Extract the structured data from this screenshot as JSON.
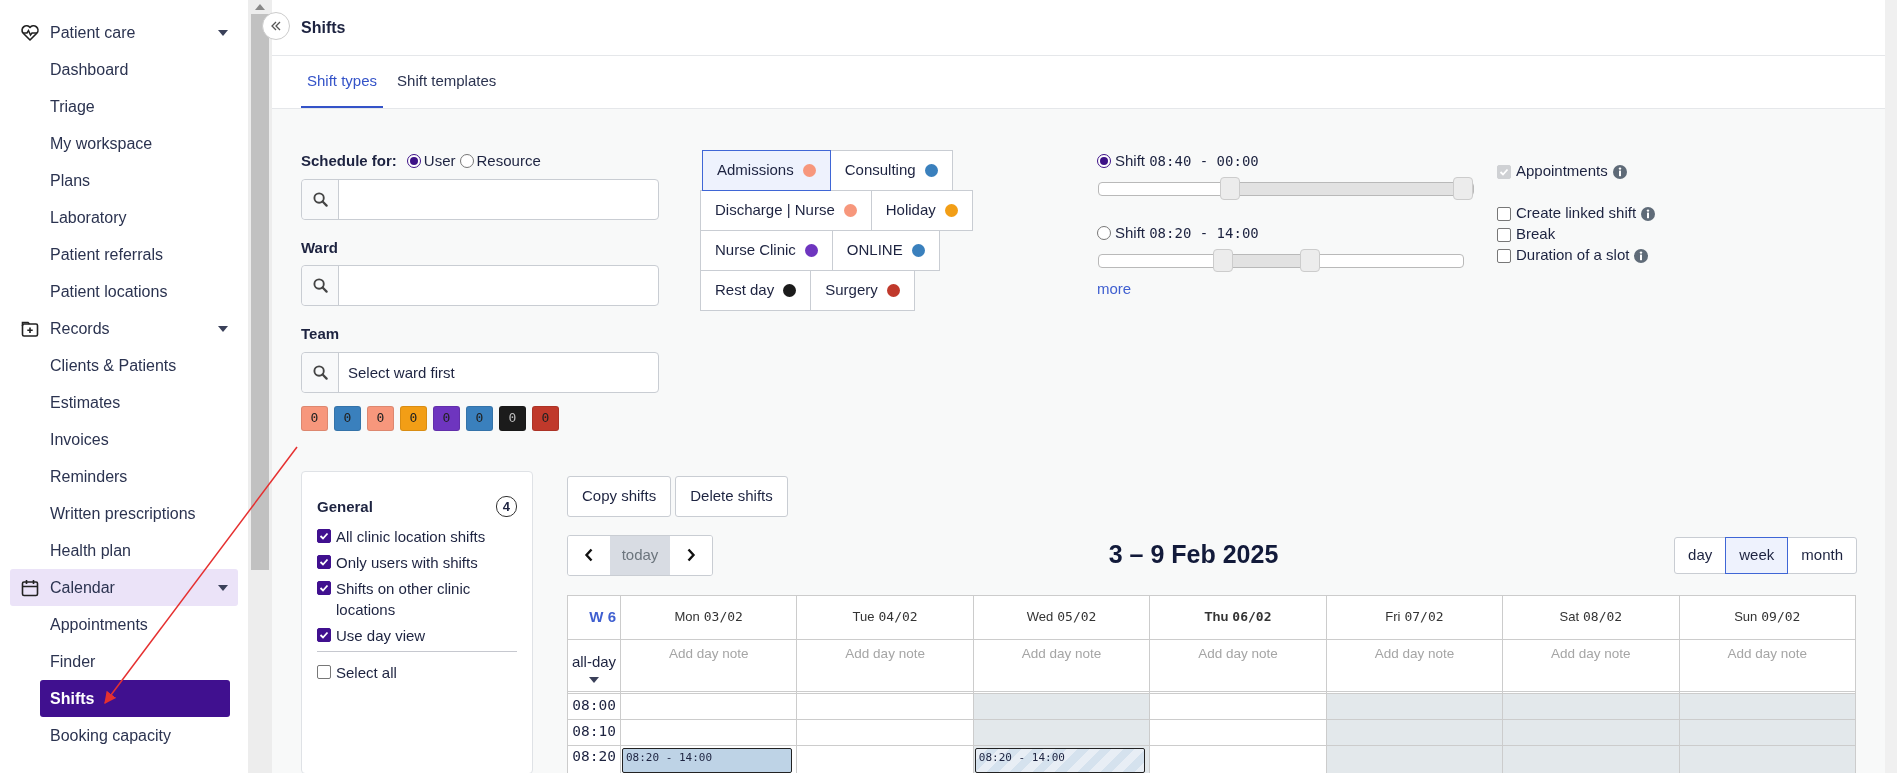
{
  "sidebar": {
    "sections": [
      {
        "label": "Patient care",
        "expanded": true,
        "selected": false,
        "children": [
          {
            "label": "Dashboard",
            "selected": false
          },
          {
            "label": "Triage",
            "selected": false
          },
          {
            "label": "My workspace",
            "selected": false
          },
          {
            "label": "Plans",
            "selected": false
          },
          {
            "label": "Laboratory",
            "selected": false
          },
          {
            "label": "Patient referrals",
            "selected": false
          },
          {
            "label": "Patient locations",
            "selected": false
          }
        ]
      },
      {
        "label": "Records",
        "expanded": true,
        "selected": false,
        "children": [
          {
            "label": "Clients & Patients",
            "selected": false
          },
          {
            "label": "Estimates",
            "selected": false
          },
          {
            "label": "Invoices",
            "selected": false
          },
          {
            "label": "Reminders",
            "selected": false
          },
          {
            "label": "Written prescriptions",
            "selected": false
          },
          {
            "label": "Health plan",
            "selected": false
          }
        ]
      },
      {
        "label": "Calendar",
        "expanded": true,
        "selected": true,
        "children": [
          {
            "label": "Appointments",
            "selected": false
          },
          {
            "label": "Finder",
            "selected": false
          },
          {
            "label": "Shifts",
            "selected": true
          },
          {
            "label": "Booking capacity",
            "selected": false
          }
        ]
      }
    ]
  },
  "page": {
    "title": "Shifts"
  },
  "tabs": [
    {
      "label": "Shift types",
      "selected": true
    },
    {
      "label": "Shift templates",
      "selected": false
    }
  ],
  "form": {
    "schedule_label": "Schedule for:",
    "schedule_options": [
      {
        "label": "User",
        "selected": true
      },
      {
        "label": "Resource",
        "selected": false
      }
    ],
    "fields": [
      {
        "label": "Ward"
      },
      {
        "label": "Team",
        "value": "Select ward first"
      }
    ],
    "swatches": [
      {
        "color": "#f7977c",
        "count": "0"
      },
      {
        "color": "#3a80bd",
        "count": "0"
      },
      {
        "color": "#f7977c",
        "count": "0"
      },
      {
        "color": "#f29e16",
        "count": "0"
      },
      {
        "color": "#6e35bf",
        "count": "0"
      },
      {
        "color": "#3a80bd",
        "count": "0"
      },
      {
        "color": "#1b1b1b",
        "count": "0"
      },
      {
        "color": "#c0392b",
        "count": "0"
      }
    ]
  },
  "shift_type_rows": [
    {
      "items": [
        {
          "label": "Admissions",
          "color": "#f7977c",
          "selected": true
        },
        {
          "label": "Consulting",
          "color": "#3a80bd",
          "selected": false
        }
      ]
    },
    {
      "items": [
        {
          "label": "Discharge | Nurse",
          "color": "#f7977c",
          "selected": false
        },
        {
          "label": "Holiday",
          "color": "#f29e16",
          "selected": false
        }
      ]
    },
    {
      "items": [
        {
          "label": "Nurse Clinic",
          "color": "#6e35bf",
          "selected": false
        },
        {
          "label": "ONLINE",
          "color": "#3a80bd",
          "selected": false
        }
      ]
    },
    {
      "items": [
        {
          "label": "Rest day",
          "color": "#1b1b1b",
          "selected": false
        },
        {
          "label": "Surgery",
          "color": "#c0392b",
          "selected": false
        }
      ]
    }
  ],
  "shifts": [
    {
      "label": "Shift",
      "time": "08:40 - 00:00",
      "selected": true,
      "handles": [
        {
          "level": 0.35
        },
        {
          "level": 1
        }
      ]
    },
    {
      "label": "Shift",
      "time": "08:20 - 14:00",
      "selected": false,
      "handles": [
        {
          "level": 0.34
        },
        {
          "level": 0.58
        }
      ]
    }
  ],
  "more_link": "more",
  "options": [
    {
      "label": "Appointments",
      "checked": true,
      "disabled": true,
      "info": true
    },
    {
      "label": "Create linked shift",
      "checked": false,
      "disabled": false,
      "info": true
    },
    {
      "label": "Break",
      "checked": false,
      "disabled": false,
      "info": false
    },
    {
      "label": "Duration of a slot",
      "checked": false,
      "disabled": false,
      "info": true
    }
  ],
  "filters": {
    "title": "General",
    "count": "4",
    "items": [
      {
        "label": "All clinic location shifts",
        "checked": true
      },
      {
        "label": "Only users with shifts",
        "checked": true
      },
      {
        "label": "Shifts on other clinic locations",
        "checked": true
      },
      {
        "label": "Use day view",
        "checked": true
      }
    ],
    "select_all": {
      "label": "Select all",
      "checked": false
    }
  },
  "actions": [
    "Copy shifts",
    "Delete shifts"
  ],
  "nav": {
    "today": "today"
  },
  "range_title": "3 – 9 Feb 2025",
  "views": [
    {
      "label": "day",
      "selected": false
    },
    {
      "label": "week",
      "selected": true
    },
    {
      "label": "month",
      "selected": false
    }
  ],
  "calendar": {
    "week": "W 6",
    "allday": "all-day",
    "times": [
      "08:00",
      "08:10",
      "08:20"
    ],
    "days": [
      {
        "weekday": "Mon",
        "date": "03/02",
        "today": false,
        "shaded": false,
        "note": "Add day note",
        "events": [
          {
            "label": "08:20 - 14:00",
            "kind": "solid"
          }
        ]
      },
      {
        "weekday": "Tue",
        "date": "04/02",
        "today": false,
        "shaded": false,
        "note": "Add day note"
      },
      {
        "weekday": "Wed",
        "date": "05/02",
        "today": false,
        "shaded": true,
        "note": "Add day note",
        "events": [
          {
            "label": "08:20 - 14:00",
            "kind": "striped"
          }
        ]
      },
      {
        "weekday": "Thu",
        "date": "06/02",
        "today": true,
        "shaded": false,
        "note": "Add day note"
      },
      {
        "weekday": "Fri",
        "date": "07/02",
        "today": false,
        "shaded": true,
        "note": "Add day note"
      },
      {
        "weekday": "Sat",
        "date": "08/02",
        "today": false,
        "shaded": true,
        "note": "Add day note"
      },
      {
        "weekday": "Sun",
        "date": "09/02",
        "today": false,
        "shaded": true,
        "note": "Add day note"
      }
    ]
  }
}
